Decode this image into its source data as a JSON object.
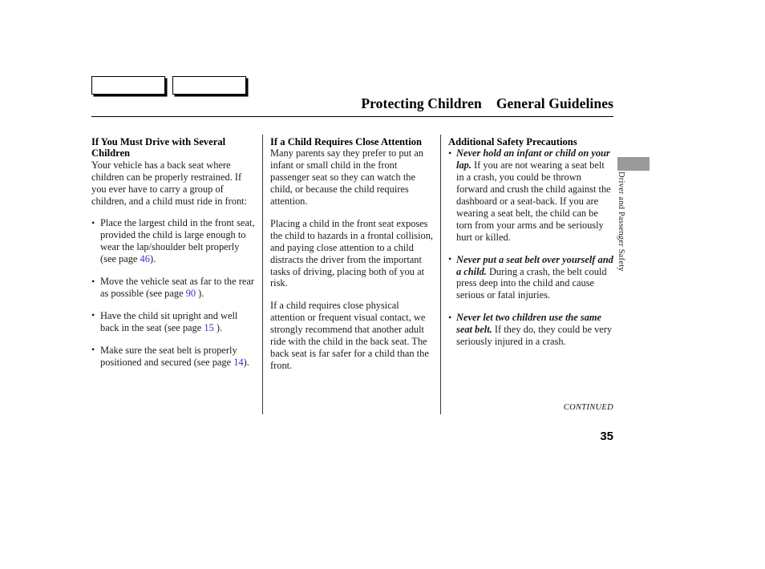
{
  "header": {
    "tab_boxes": [
      "",
      ""
    ],
    "chapter_title": "Protecting Children",
    "section_title": "General Guidelines"
  },
  "side_tab": {
    "label": "Driver and Passenger Safety",
    "marker_color": "#9a9a9a"
  },
  "columns": {
    "col1": {
      "heading": "If You Must Drive with Several Children",
      "intro": "Your vehicle has a back seat where children can be properly restrained. If you ever have to carry a group of children, and a child must ride in front:",
      "bullets": [
        {
          "text_before": "Place the largest child in the front seat, provided the child is large enough to wear the lap/shoulder belt properly (see page ",
          "pageref": "46",
          "text_after": ")."
        },
        {
          "text_before": "Move the vehicle seat as far to the rear as possible (see page ",
          "pageref": "90",
          "text_after": " )."
        },
        {
          "text_before": "Have the child sit upright and well back in the seat (see page ",
          "pageref": "15",
          "text_after": " )."
        },
        {
          "text_before": "Make sure the seat belt is properly positioned and secured (see page ",
          "pageref": "14",
          "text_after": ")."
        }
      ]
    },
    "col2": {
      "heading": "If a Child Requires Close Attention",
      "para1": "Many parents say they prefer to put an infant or small child in the front passenger seat so they can watch the child, or because the child requires attention.",
      "para2": "Placing a child in the front seat exposes the child to hazards in a frontal collision, and paying close attention to a child distracts the driver from the important tasks of driving, placing both of you at risk.",
      "para3": "If a child requires close physical attention or frequent visual contact, we strongly recommend that another adult ride with the child in the back seat. The back seat is far safer for a child than the front."
    },
    "col3": {
      "heading": "Additional Safety Precautions",
      "bullets": [
        {
          "lead": "Never hold an infant or child on your lap.",
          "body": " If you are not wearing a seat belt in a crash, you could be thrown forward and crush the child against the dashboard or a seat-back. If you are wearing a seat belt, the child can be torn from your arms and be seriously hurt or killed."
        },
        {
          "lead": "Never put a seat belt over yourself and a child.",
          "body": " During a crash, the belt could press deep into the child and cause serious or fatal injuries."
        },
        {
          "lead": "Never let two children use the same seat belt.",
          "body": " If they do, they could be very seriously injured in a crash."
        }
      ]
    }
  },
  "footer": {
    "continued": "CONTINUED",
    "page_number": "35"
  },
  "colors": {
    "page_reference_link": "#3333cc",
    "rule": "#000000",
    "text": "#1a1a1a"
  }
}
